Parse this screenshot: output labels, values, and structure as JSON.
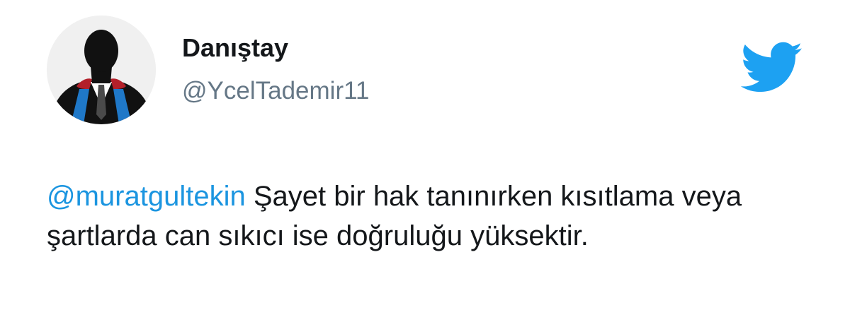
{
  "user": {
    "display_name": "Danıştay",
    "handle": "@YcelTademir11"
  },
  "tweet": {
    "mention": "@muratgultekin",
    "body": " Şayet bir hak tanınırken kısıtlama veya şartlarda can sıkıcı ise doğruluğu yüksektir."
  },
  "icons": {
    "avatar": "silhouette-avatar-icon",
    "logo": "twitter-bird-icon"
  },
  "colors": {
    "mention": "#1b95e0",
    "handle": "#657786",
    "text": "#14171a",
    "bird": "#1da1f2"
  }
}
